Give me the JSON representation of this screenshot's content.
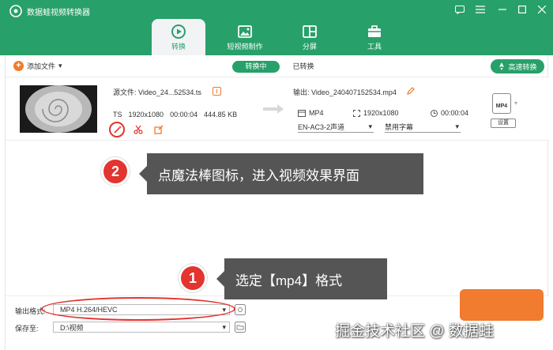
{
  "app": {
    "title": "数据蛙视频转换器"
  },
  "nav": {
    "tabs": [
      {
        "label": "转换",
        "icon": "convert-icon",
        "active": true
      },
      {
        "label": "短视频制作",
        "icon": "short-video-icon",
        "active": false
      },
      {
        "label": "分屏",
        "icon": "split-screen-icon",
        "active": false
      },
      {
        "label": "工具",
        "icon": "toolbox-icon",
        "active": false
      }
    ]
  },
  "toolbar": {
    "add_file": "添加文件",
    "tab_converting": "转换中",
    "tab_converted": "已转换",
    "fast_convert": "高速转换"
  },
  "file": {
    "source_name": "源文件: Video_24...52534.ts",
    "format": "TS",
    "resolution": "1920x1080",
    "duration": "00:00:04",
    "size": "444.85 KB",
    "output_name": "输出: Video_240407152534.mp4",
    "out_format": "MP4",
    "out_resolution": "1920x1080",
    "out_duration": "00:00:04",
    "audio_track": "EN-AC3-2声道",
    "subtitle": "禁用字幕",
    "badge": "MP4",
    "settings": "设置"
  },
  "annotations": [
    {
      "number": "2",
      "text": "点魔法棒图标，进入视频效果界面"
    },
    {
      "number": "1",
      "text": "选定【mp4】格式"
    }
  ],
  "bottom": {
    "output_format_label": "输出格式:",
    "output_format_value": "MP4 H.264/HEVC",
    "save_to_label": "保存至:",
    "save_to_value": "D:\\视频"
  },
  "watermark": "掘金技术社区 @ 数据蛙",
  "colors": {
    "brand": "#28a06a",
    "accent": "#f17b2e",
    "annotation": "#e3342f"
  }
}
